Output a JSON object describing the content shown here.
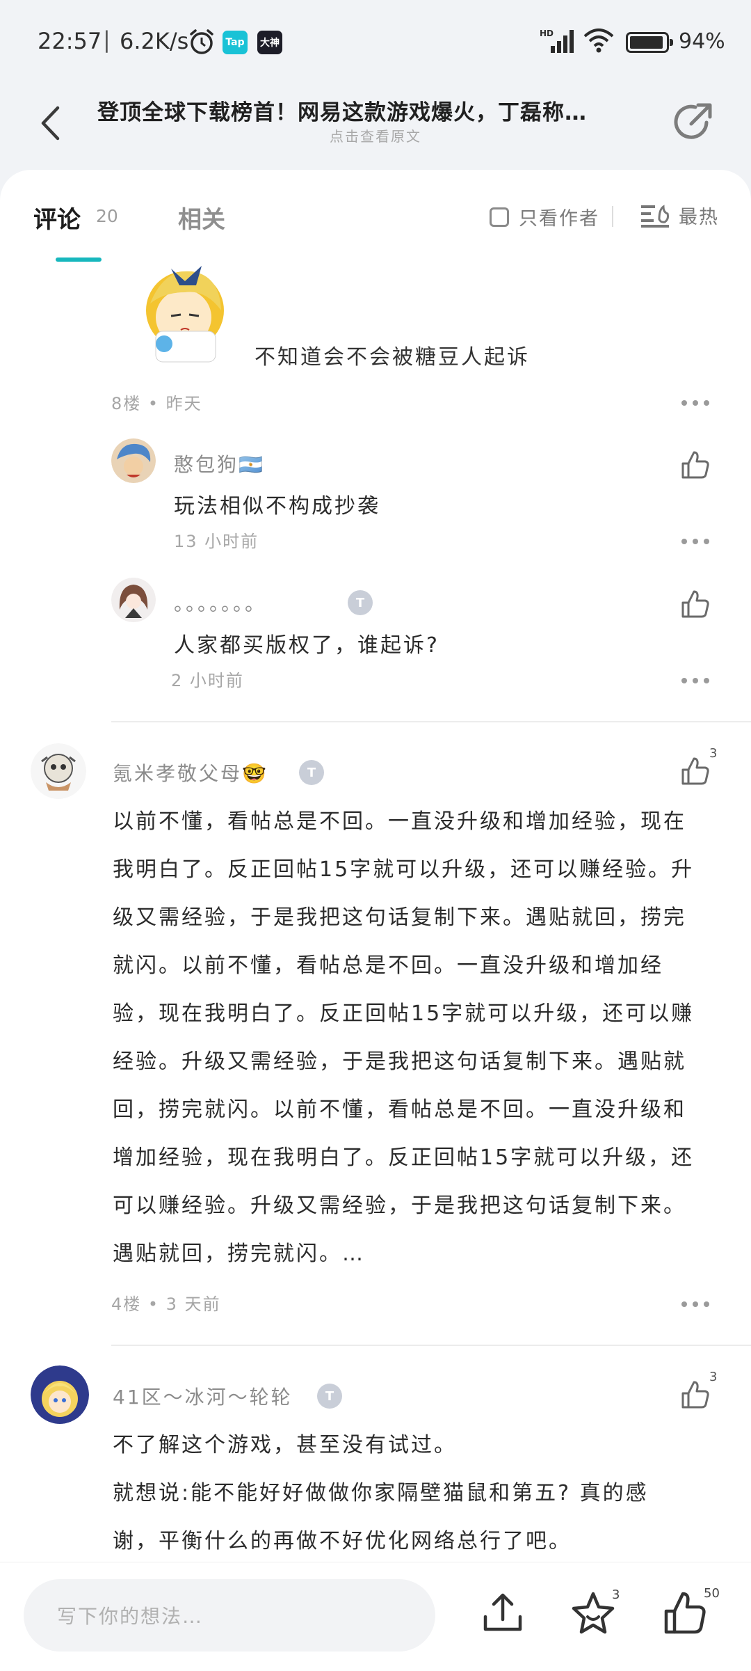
{
  "status_bar": {
    "time": "22:57",
    "separator": "|",
    "speed": "6.2K/s",
    "app_icon_1": "Tap",
    "app_icon_2": "大神",
    "network": "HD",
    "battery_percent": 0.94,
    "battery_text": "94%"
  },
  "header": {
    "title": "登顶全球下载榜首！网易这款游戏爆火，丁磊称…",
    "view_original": "点击查看原文"
  },
  "tabs": {
    "comments_label": "评论",
    "comments_count": "20",
    "related_label": "相关",
    "author_only_label": "只看作者",
    "sort_label": "最热"
  },
  "thread_8": {
    "text": "不知道会不会被糖豆人起诉",
    "meta": "8楼 • 昨天",
    "replies": [
      {
        "name": "憨包狗🇦🇷",
        "text": "玩法相似不构成抄袭",
        "time": "13 小时前"
      },
      {
        "name": "。。。。。。。",
        "badge": "T",
        "text": "人家都买版权了，谁起诉?",
        "time": "2 小时前"
      }
    ]
  },
  "comment_4": {
    "name": "氪米孝敬父母🤓",
    "badge": "T",
    "likes": "3",
    "lines": [
      "以前不懂，看帖总是不回。一直没升级和增加经验，现在",
      "我明白了。反正回帖15字就可以升级，还可以赚经验。升",
      "级又需经验，于是我把这句话复制下来。遇贴就回，捞完",
      "就闪。以前不懂，看帖总是不回。一直没升级和增加经",
      "验，现在我明白了。反正回帖15字就可以升级，还可以赚",
      "经验。升级又需经验，于是我把这句话复制下来。遇贴就",
      "回，捞完就闪。以前不懂，看帖总是不回。一直没升级和",
      "增加经验，现在我明白了。反正回帖15字就可以升级，还",
      "可以赚经验。升级又需经验，于是我把这句话复制下来。",
      "遇贴就回，捞完就闪。…"
    ],
    "meta": "4楼 • 3 天前"
  },
  "comment_41": {
    "name": "41区～冰河～轮轮",
    "badge": "T",
    "likes": "3",
    "lines": [
      "不了解这个游戏，甚至没有试过。",
      "就想说:能不能好好做做你家隔壁猫鼠和第五? 真的感",
      "谢，平衡什么的再做不好优化网络总行了吧。"
    ]
  },
  "bottom_bar": {
    "placeholder": "写下你的想法…",
    "star_count": "3",
    "like_count": "50"
  },
  "colors": {
    "accent": "#17b7bd",
    "background": "#f1f3f6"
  },
  "icons": [
    "back-arrow-icon",
    "share-icon",
    "checkbox-icon",
    "sort-icon",
    "more-icon",
    "like-icon",
    "upload-icon",
    "star-icon",
    "alarm-icon",
    "signal-icon",
    "wifi-icon",
    "battery-icon"
  ]
}
